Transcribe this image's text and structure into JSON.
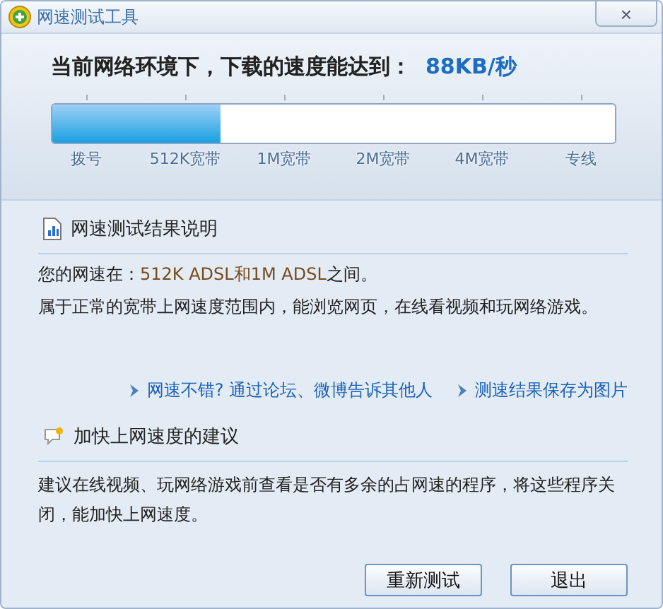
{
  "window": {
    "title": "网速测试工具",
    "close": "×"
  },
  "result": {
    "label": "当前网络环境下，下载的速度能达到：",
    "speed": "88KB/秒"
  },
  "meter": {
    "level": 0.3,
    "ticks": [
      "拨号",
      "512K宽带",
      "1M宽带",
      "2M宽带",
      "4M宽带",
      "专线"
    ]
  },
  "explain": {
    "heading": "网速测试结果说明",
    "speed_line": {
      "prefix": "您的网速在：",
      "highlight": "512K ADSL和1M ADSL",
      "suffix": "之间。"
    },
    "description": "属于正常的宽带上网速度范围内，能浏览网页，在线看视频和玩网络游戏。"
  },
  "links": [
    "网速不错? 通过论坛、微博告诉其他人",
    "测速结果保存为图片"
  ],
  "advice": {
    "heading": "加快上网速度的建议",
    "text": "建议在线视频、玩网络游戏前查看是否有多余的占网速的程序，将这些程序关闭，能加快上网速度。"
  },
  "buttons": [
    "重新测试",
    "退出"
  ]
}
